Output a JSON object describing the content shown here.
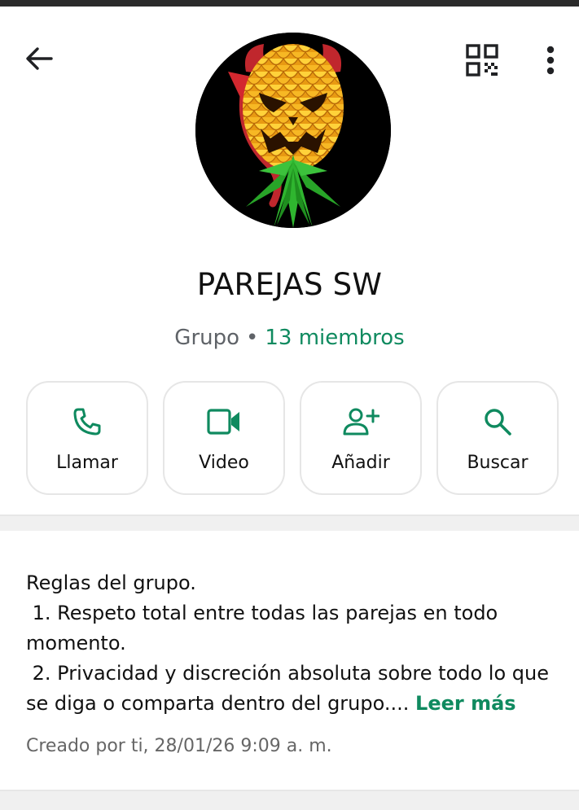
{
  "group": {
    "name": "PAREJAS SW",
    "type": "Grupo",
    "separator": "•",
    "members": "13 miembros"
  },
  "actions": [
    {
      "label": "Llamar",
      "icon": "phone-icon"
    },
    {
      "label": "Video",
      "icon": "video-icon"
    },
    {
      "label": "Añadir",
      "icon": "add-person-icon"
    },
    {
      "label": "Buscar",
      "icon": "search-icon"
    }
  ],
  "description": {
    "lines": [
      "Reglas del grupo.",
      " 1. Respeto total entre todas las parejas en todo",
      "momento.",
      " 2. Privacidad y discreción absoluta sobre todo lo que",
      "se diga o comparta dentro del grupo.... "
    ],
    "read_more": "Leer más"
  },
  "created": "Creado por ti, 28/01/26 9:09 a. m.",
  "colors": {
    "accent": "#0f8a5f",
    "text": "#111111",
    "muted": "#5f6368"
  }
}
